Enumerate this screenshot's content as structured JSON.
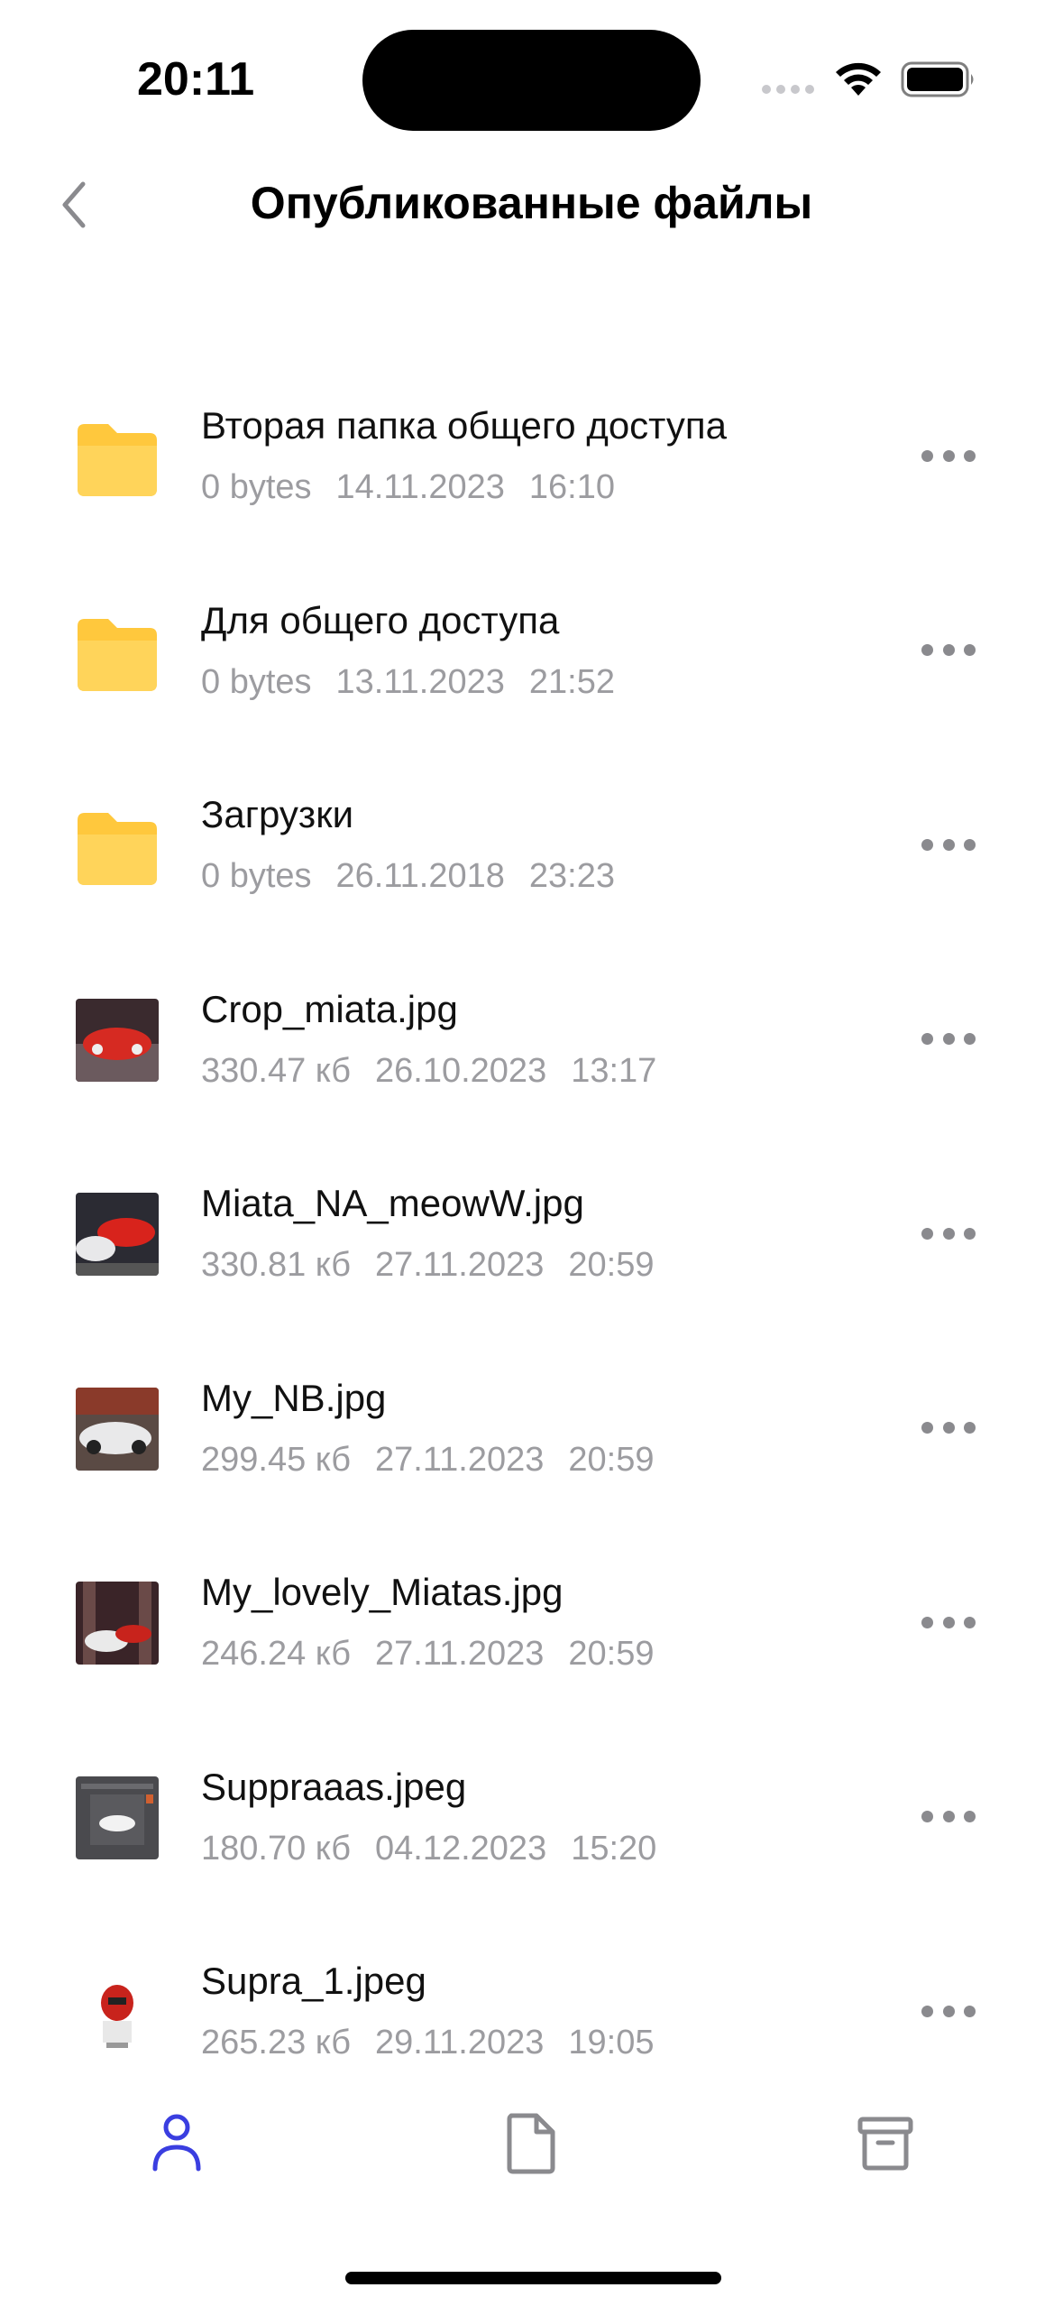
{
  "status_bar": {
    "time": "20:11",
    "icons": [
      "cellular-signal-icon",
      "wifi-icon",
      "battery-icon"
    ]
  },
  "nav": {
    "back_icon": "chevron-left-icon",
    "title": "Опубликованные файлы"
  },
  "files": [
    {
      "kind": "folder",
      "name": "Вторая папка общего доступа",
      "size": "0 bytes",
      "date": "14.11.2023",
      "time": "16:10"
    },
    {
      "kind": "folder",
      "name": "Для общего доступа",
      "size": "0 bytes",
      "date": "13.11.2023",
      "time": "21:52"
    },
    {
      "kind": "folder",
      "name": "Загрузки",
      "size": "0 bytes",
      "date": "26.11.2018",
      "time": "23:23"
    },
    {
      "kind": "image",
      "name": "Crop_miata.jpg",
      "size": "330.47 кб",
      "date": "26.10.2023",
      "time": "13:17"
    },
    {
      "kind": "image",
      "name": "Miata_NA_meowW.jpg",
      "size": "330.81 кб",
      "date": "27.11.2023",
      "time": "20:59"
    },
    {
      "kind": "image",
      "name": "My_NB.jpg",
      "size": "299.45 кб",
      "date": "27.11.2023",
      "time": "20:59"
    },
    {
      "kind": "image",
      "name": "My_lovely_Miatas.jpg",
      "size": "246.24 кб",
      "date": "27.11.2023",
      "time": "20:59"
    },
    {
      "kind": "image",
      "name": "Suppraaas.jpeg",
      "size": "180.70 кб",
      "date": "04.12.2023",
      "time": "15:20"
    },
    {
      "kind": "image",
      "name": "Supra_1.jpeg",
      "size": "265.23 кб",
      "date": "29.11.2023",
      "time": "19:05"
    }
  ],
  "tab_bar": {
    "tabs": [
      {
        "icon": "person-icon",
        "active": true
      },
      {
        "icon": "document-icon",
        "active": false
      },
      {
        "icon": "archive-icon",
        "active": false
      }
    ],
    "active_color": "#3a3ee0",
    "inactive_color": "#8a8a8e"
  },
  "colors": {
    "folder": "#ffc83d",
    "meta_text": "#9c9ca0"
  }
}
